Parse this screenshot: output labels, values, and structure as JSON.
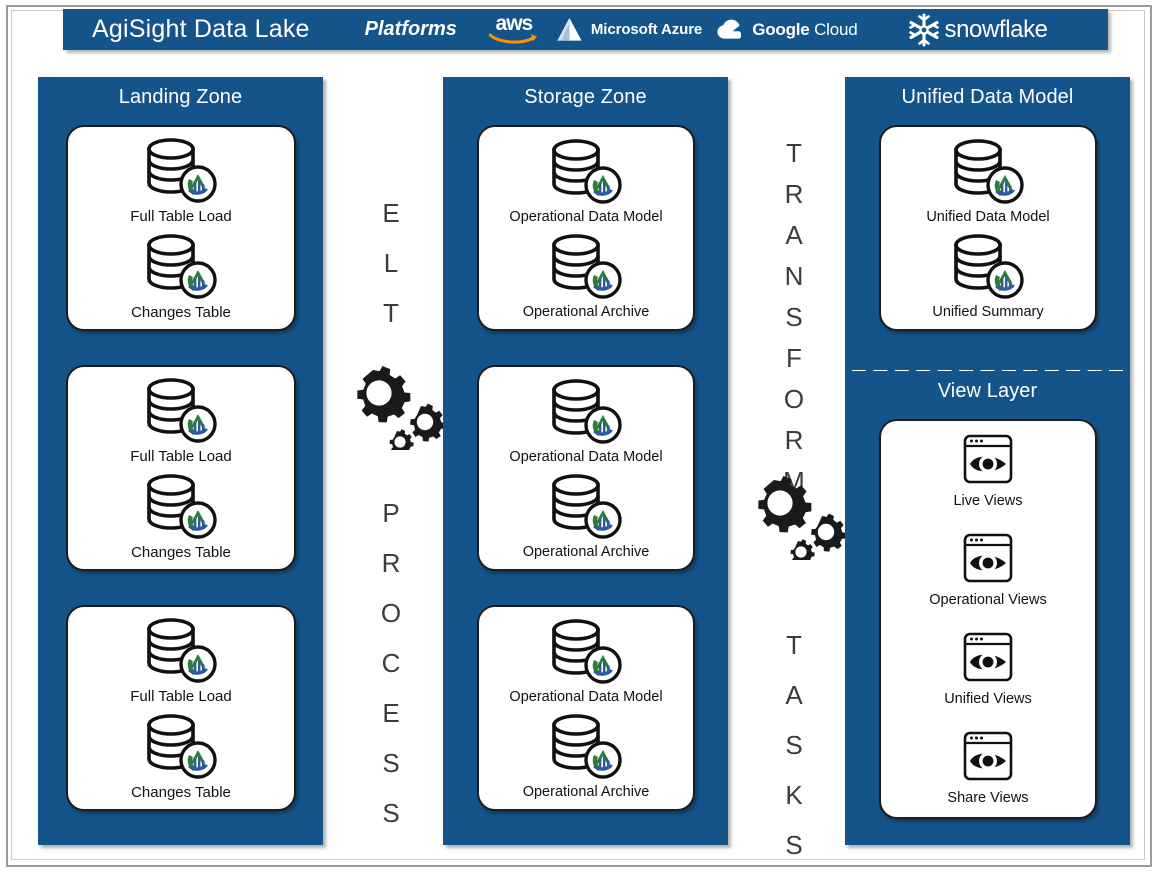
{
  "header": {
    "brand": "AgiSight Data Lake",
    "platforms_label": "Platforms",
    "logos": [
      {
        "id": "aws-logo",
        "text": "aws"
      },
      {
        "id": "microsoft-azure-logo",
        "text": "Microsoft Azure"
      },
      {
        "id": "google-cloud-logo",
        "text_bold": "Google",
        "text_light": "Cloud"
      },
      {
        "id": "snowflake-logo",
        "text": "snowflake"
      }
    ]
  },
  "colors": {
    "brand_blue": "#14548a",
    "badge_green": "#2e7d3a",
    "badge_blue": "#2b5d9e",
    "frame_gray": "#9b9b9b",
    "text_dark": "#3c3c3c"
  },
  "zones": {
    "landing": {
      "title": "Landing Zone",
      "cards": [
        {
          "nodes": [
            {
              "icon": "database-icon",
              "label": "Full Table Load"
            },
            {
              "icon": "database-icon",
              "label": "Changes Table"
            }
          ]
        },
        {
          "nodes": [
            {
              "icon": "database-icon",
              "label": "Full Table Load"
            },
            {
              "icon": "database-icon",
              "label": "Changes Table"
            }
          ]
        },
        {
          "nodes": [
            {
              "icon": "database-icon",
              "label": "Full Table Load"
            },
            {
              "icon": "database-icon",
              "label": "Changes Table"
            }
          ]
        }
      ]
    },
    "storage": {
      "title": "Storage Zone",
      "cards": [
        {
          "nodes": [
            {
              "icon": "database-icon",
              "label": "Operational Data Model"
            },
            {
              "icon": "database-icon",
              "label": "Operational Archive"
            }
          ]
        },
        {
          "nodes": [
            {
              "icon": "database-icon",
              "label": "Operational Data Model"
            },
            {
              "icon": "database-icon",
              "label": "Operational Archive"
            }
          ]
        },
        {
          "nodes": [
            {
              "icon": "database-icon",
              "label": "Operational Data Model"
            },
            {
              "icon": "database-icon",
              "label": "Operational Archive"
            }
          ]
        }
      ]
    },
    "unified": {
      "title": "Unified Data Model",
      "cards": [
        {
          "nodes": [
            {
              "icon": "database-icon",
              "label": "Unified Data Model"
            },
            {
              "icon": "database-icon",
              "label": "Unified Summary"
            }
          ]
        }
      ]
    },
    "view": {
      "title": "View Layer",
      "cards": [
        {
          "nodes": [
            {
              "icon": "browser-eye-icon",
              "label": "Live Views"
            },
            {
              "icon": "browser-eye-icon",
              "label": "Operational Views"
            },
            {
              "icon": "browser-eye-icon",
              "label": "Unified Views"
            },
            {
              "icon": "browser-eye-icon",
              "label": "Share Views"
            }
          ]
        }
      ]
    }
  },
  "process_columns": [
    {
      "id": "elt-process",
      "top_text": "ELT",
      "bottom_text": "PROCESS",
      "icon": "gears-icon"
    },
    {
      "id": "transform-tasks",
      "top_text": "TRANSFORM",
      "bottom_text": "TASKS",
      "icon": "gears-icon"
    }
  ]
}
